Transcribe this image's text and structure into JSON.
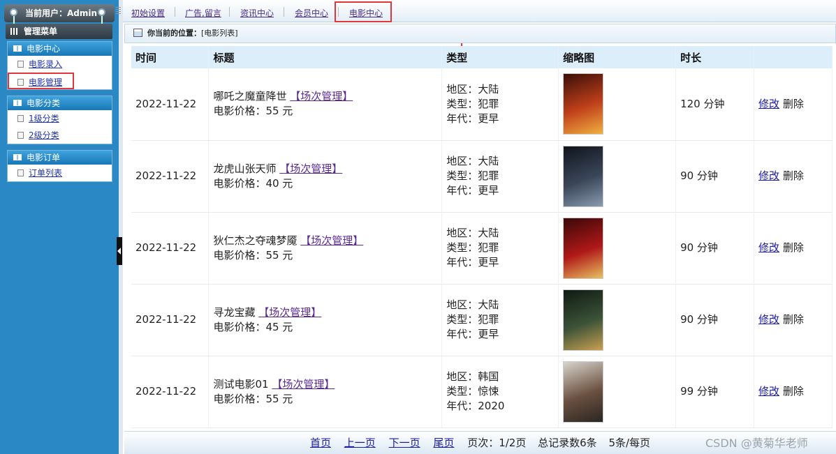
{
  "sidebar": {
    "user_label": "当前用户：Admin",
    "menu_title": "管理菜单",
    "groups": [
      {
        "title": "电影中心",
        "items": [
          "电影录入",
          "电影管理"
        ]
      },
      {
        "title": "电影分类",
        "items": [
          "1级分类",
          "2级分类"
        ]
      },
      {
        "title": "电影订单",
        "items": [
          "订单列表"
        ]
      }
    ]
  },
  "topnav": {
    "items": [
      "初始设置",
      "广告,留言",
      "资讯中心",
      "会员中心",
      "电影中心"
    ]
  },
  "breadcrumb": {
    "label": "你当前的位置：",
    "value": "[电影列表]"
  },
  "table": {
    "headers": [
      "时间",
      "标题",
      "类型",
      "缩略图",
      "时长",
      ""
    ],
    "manage_label": "【场次管理】",
    "edit_label": "修改",
    "delete_label": "删除",
    "rows": [
      {
        "date": "2022-11-22",
        "title": "哪吒之魔童降世",
        "price": "电影价格：55 元",
        "region": "地区：大陆",
        "genre": "类型：犯罪",
        "era": "年代：更早",
        "duration": "120 分钟",
        "poster_colors": [
          "#3a0f08",
          "#c0401a",
          "#f0b040"
        ]
      },
      {
        "date": "2022-11-22",
        "title": "龙虎山张天师",
        "price": "电影价格：40 元",
        "region": "地区：大陆",
        "genre": "类型：犯罪",
        "era": "年代：更早",
        "duration": "90 分钟",
        "poster_colors": [
          "#10141c",
          "#3a4658",
          "#8a9ab0"
        ]
      },
      {
        "date": "2022-11-22",
        "title": "狄仁杰之夺魂梦魇",
        "price": "电影价格：55 元",
        "region": "地区：大陆",
        "genre": "类型：犯罪",
        "era": "年代：更早",
        "duration": "90 分钟",
        "poster_colors": [
          "#3a0808",
          "#b01818",
          "#e8c060"
        ]
      },
      {
        "date": "2022-11-22",
        "title": "寻龙宝藏",
        "price": "电影价格：45 元",
        "region": "地区：大陆",
        "genre": "类型：犯罪",
        "era": "年代：更早",
        "duration": "90 分钟",
        "poster_colors": [
          "#0e1a12",
          "#3c5238",
          "#c8a050"
        ]
      },
      {
        "date": "2022-11-22",
        "title": "测试电影01",
        "price": "电影价格：55 元",
        "region": "地区：韩国",
        "genre": "类型：惊悚",
        "era": "年代：2020",
        "duration": "99 分钟",
        "poster_colors": [
          "#d8d4cc",
          "#6a5040",
          "#2a2622"
        ]
      }
    ]
  },
  "pager": {
    "first": "首页",
    "prev": "上一页",
    "next": "下一页",
    "last": "尾页",
    "page_info": "页次：1/2页",
    "total": "总记录数6条",
    "per_page": "5条/每页"
  },
  "watermark": "CSDN @黄菊华老师",
  "colors": {
    "sidebar_bg": "#2a88c4",
    "highlight": "#e0363c",
    "header_bg": "#ddeefb"
  }
}
